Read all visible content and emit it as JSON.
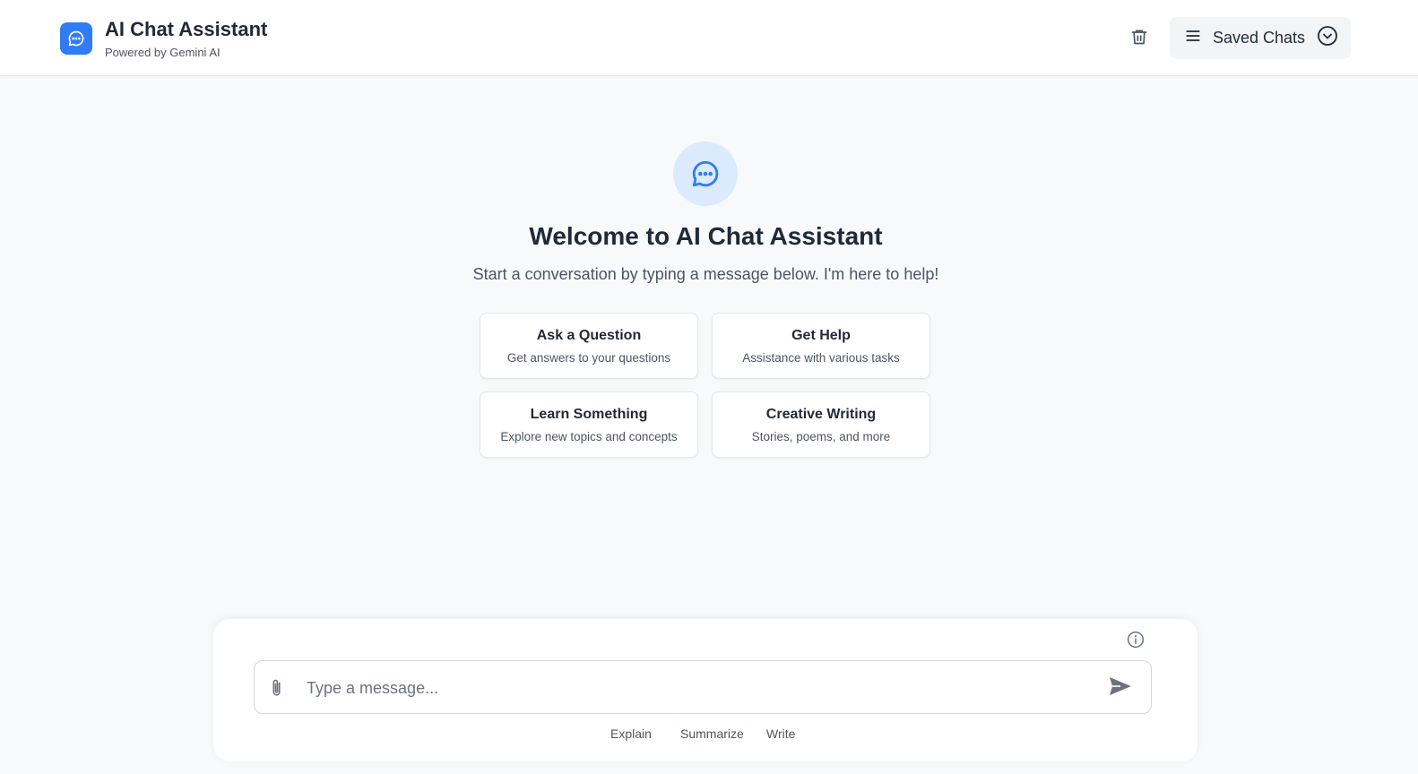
{
  "header": {
    "title": "AI Chat Assistant",
    "subtitle": "Powered by Gemini AI",
    "icons": {
      "brand": "chat-bubble-icon",
      "trash": "trash-icon",
      "menu": "menu-icon",
      "chevron": "chevron-down-circle-icon"
    },
    "saved_chats_label": "Saved Chats"
  },
  "welcome": {
    "icon": "chat-bubble-icon",
    "title": "Welcome to AI Chat Assistant",
    "subtitle": "Start a conversation by typing a message below. I'm here to help!",
    "cards": [
      {
        "title": "Ask a Question",
        "subtitle": "Get answers to your questions"
      },
      {
        "title": "Get Help",
        "subtitle": "Assistance with various tasks"
      },
      {
        "title": "Learn Something",
        "subtitle": "Explore new topics and concepts"
      },
      {
        "title": "Creative Writing",
        "subtitle": "Stories, poems, and more"
      }
    ]
  },
  "composer": {
    "placeholder": "Type a message...",
    "value": "",
    "icons": {
      "info": "info-icon",
      "attach": "paperclip-icon",
      "send": "send-icon"
    },
    "quick_actions": [
      "Explain",
      "Summarize",
      "Write"
    ]
  },
  "colors": {
    "accent": "#2f7cf6",
    "accent_light": "#dbeafe",
    "background": "#f8f9fb",
    "text": "#1f2937",
    "muted": "#4b5563"
  }
}
